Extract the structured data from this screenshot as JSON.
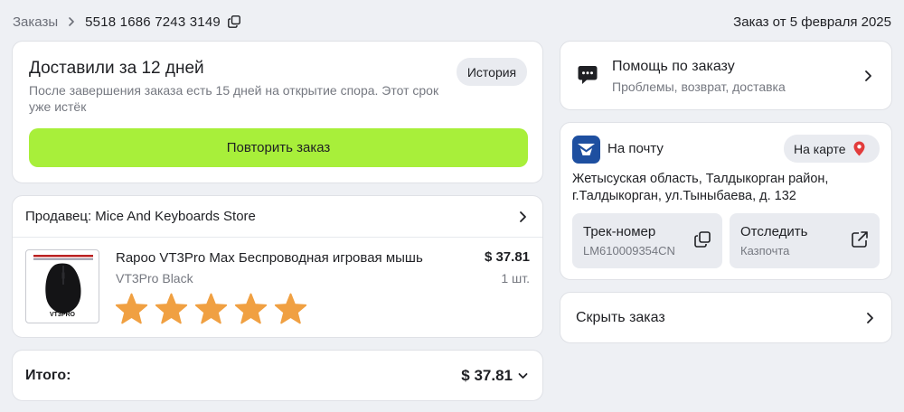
{
  "breadcrumb": {
    "root": "Заказы",
    "order_number": "5518 1686 7243 3149",
    "order_date": "Заказ от 5 февраля 2025"
  },
  "delivery": {
    "title": "Доставили за 12 дней",
    "description": "После завершения заказа есть 15 дней на открытие спора. Этот срок уже истёк",
    "history_label": "История",
    "repeat_label": "Повторить заказ",
    "accent_color": "#a8ef3a"
  },
  "seller": {
    "label": "Продавец: Mice And Keyboards Store"
  },
  "product": {
    "name": "Rapoo VT3Pro Max Беспроводная игровая мышь",
    "variant": "VT3Pro Black",
    "price": "$ 37.81",
    "quantity": "1 шт.",
    "thumb_text": "VT3PRO",
    "rating": 5,
    "rating_max": 5,
    "star_color": "#f0a042"
  },
  "total": {
    "label": "Итого:",
    "value": "$ 37.81"
  },
  "help": {
    "title": "Помощь по заказу",
    "subtitle": "Проблемы, возврат, доставка"
  },
  "post": {
    "title": "На почту",
    "map_label": "На карте",
    "address": "Жетысуская область, Талдыкорган район, г.Талдыкорган, ул.Тыныбаева, д. 132",
    "track_title": "Трек-номер",
    "track_number": "LM610009354CN",
    "follow_title": "Отследить",
    "follow_service": "Казпочта",
    "logo_color": "#1e4fa0",
    "pin_color": "#e23c3c"
  },
  "hide": {
    "label": "Скрыть заказ"
  },
  "icons": {
    "breadcrumb_separator": "chevron-right-icon",
    "copy": "copy-icon",
    "chevron": "chevron-right-icon",
    "dropdown": "chevron-down-icon",
    "chat": "chat-bubble-icon",
    "map_pin": "map-pin-icon",
    "external": "external-link-icon",
    "star": "star-icon"
  }
}
